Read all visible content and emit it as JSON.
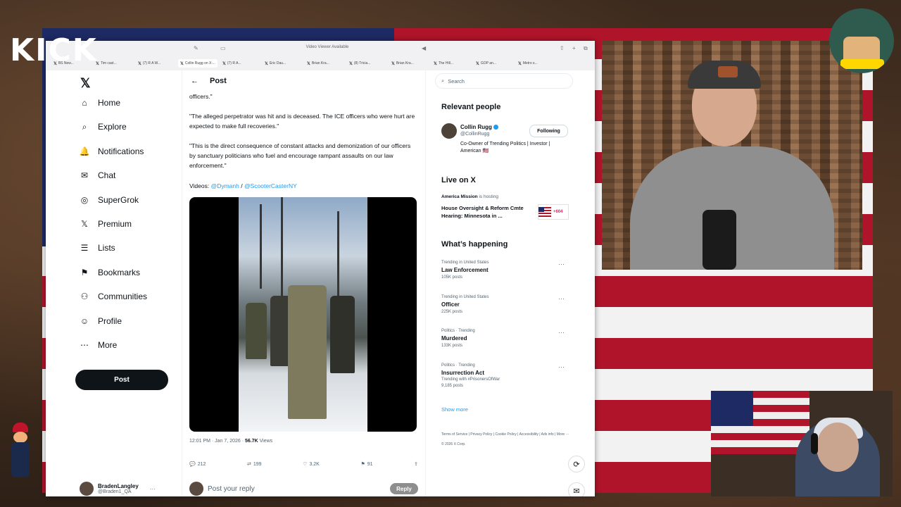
{
  "overlay": {
    "kick_logo": "KICK"
  },
  "browser": {
    "window_title": "Video Viewer Available",
    "tabs": [
      {
        "label": "BS New..."
      },
      {
        "label": "Tim cast..."
      },
      {
        "label": "(7) R A W..."
      },
      {
        "label": "Collin Rugg on X:...",
        "active": true
      },
      {
        "label": "(7) R A..."
      },
      {
        "label": "Eric Dau..."
      },
      {
        "label": "Brian Kra..."
      },
      {
        "label": "(8) Tricia..."
      },
      {
        "label": "Brian Kra..."
      },
      {
        "label": "The Hill..."
      },
      {
        "label": "GOP an..."
      },
      {
        "label": "Metro s..."
      }
    ]
  },
  "nav": {
    "items": [
      {
        "label": "Home",
        "icon": "home-icon"
      },
      {
        "label": "Explore",
        "icon": "search-icon"
      },
      {
        "label": "Notifications",
        "icon": "bell-icon"
      },
      {
        "label": "Chat",
        "icon": "mail-icon"
      },
      {
        "label": "SuperGrok",
        "icon": "grok-icon"
      },
      {
        "label": "Premium",
        "icon": "x-icon"
      },
      {
        "label": "Lists",
        "icon": "list-icon"
      },
      {
        "label": "Bookmarks",
        "icon": "bookmark-icon"
      },
      {
        "label": "Communities",
        "icon": "communities-icon"
      },
      {
        "label": "Profile",
        "icon": "profile-icon"
      },
      {
        "label": "More",
        "icon": "more-icon"
      }
    ],
    "post_button": "Post",
    "account_name": "BradenLangley",
    "account_handle": "@Braden1_QA"
  },
  "post": {
    "header": "Post",
    "text_1": "officers.\"",
    "text_2": "\"The alleged perpetrator was hit and is deceased. The ICE officers who were hurt are expected to make full recoveries.\"",
    "text_3": "\"This is the direct consequence of constant attacks and demonization of our officers by sanctuary politicians who fuel and encourage rampant assaults on our law enforcement.\"",
    "videos_label": "Videos:",
    "video_link_1": "@Dymanh",
    "video_sep": "/",
    "video_link_2": "@ScooterCasterNY",
    "time": "12:01 PM · Jan 7, 2026 · ",
    "views_count": "56.7K",
    "views_label": " Views",
    "replies": "212",
    "reposts": "199",
    "likes": "3.2K",
    "bookmarks": "91",
    "reply_placeholder": "Post your reply",
    "reply_button": "Reply"
  },
  "sidebar": {
    "search_placeholder": "Search",
    "relevant_title": "Relevant people",
    "person_name": "Collin Rugg",
    "person_handle": "@CollinRugg",
    "person_bio": "Co-Owner of Trending Politics | Investor | American 🇺🇸",
    "follow_label": "Following",
    "live_title": "Live on X",
    "live_host_name": "America Mission",
    "live_host_suffix": " is hosting",
    "live_event": "House Oversight & Reform Cmte Hearing: Minnesota in ...",
    "live_count": "+604",
    "happening_title": "What’s happening",
    "trends": [
      {
        "context": "Trending in United States",
        "name": "Law Enforcement",
        "posts": "105K posts"
      },
      {
        "context": "Trending in United States",
        "name": "Officer",
        "posts": "225K posts"
      },
      {
        "context": "Politics · Trending",
        "name": "Murdered",
        "posts": "133K posts"
      },
      {
        "context": "Politics · Trending",
        "name": "Insurrection Act",
        "extra": "Trending with #PrisonersOfWar",
        "posts": "9,185 posts"
      }
    ],
    "show_more": "Show more",
    "footer": "Terms of Service | Privacy Policy | Cookie Policy | Accessibility | Ads info | More ··· © 2026 X Corp."
  }
}
